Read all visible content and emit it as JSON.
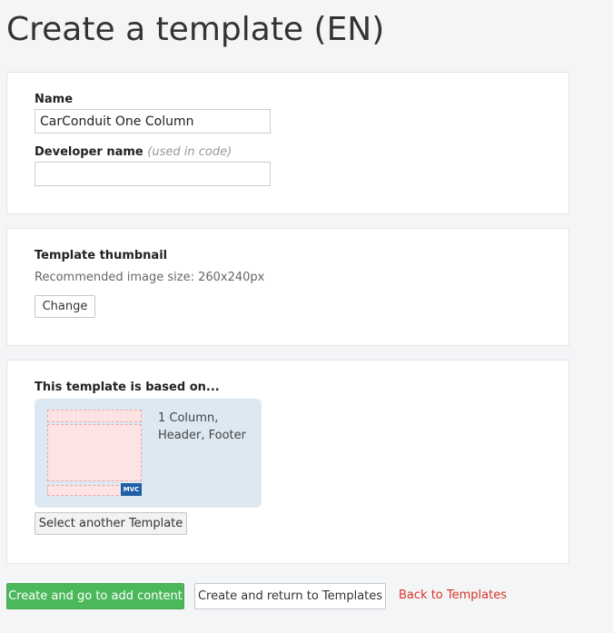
{
  "page": {
    "title": "Create a template (EN)"
  },
  "name_field": {
    "label": "Name",
    "value": "CarConduit One Column"
  },
  "developer_name_field": {
    "label": "Developer name",
    "hint": "(used in code)",
    "value": ""
  },
  "thumbnail": {
    "label": "Template thumbnail",
    "recommended": "Recommended image size: 260x240px",
    "change_label": "Change"
  },
  "base_template": {
    "label": "This template is based on...",
    "description": "1 Column, Header, Footer",
    "badge": "MVC",
    "select_label": "Select another Template"
  },
  "actions": {
    "create_add_content": "Create and go to add content",
    "create_return": "Create and return to Templates",
    "back": "Back to Templates"
  },
  "colors": {
    "primary": "#4cb85c",
    "link_red": "#d9342b",
    "card_bg": "#dde9f2",
    "badge": "#1f5fa6"
  }
}
